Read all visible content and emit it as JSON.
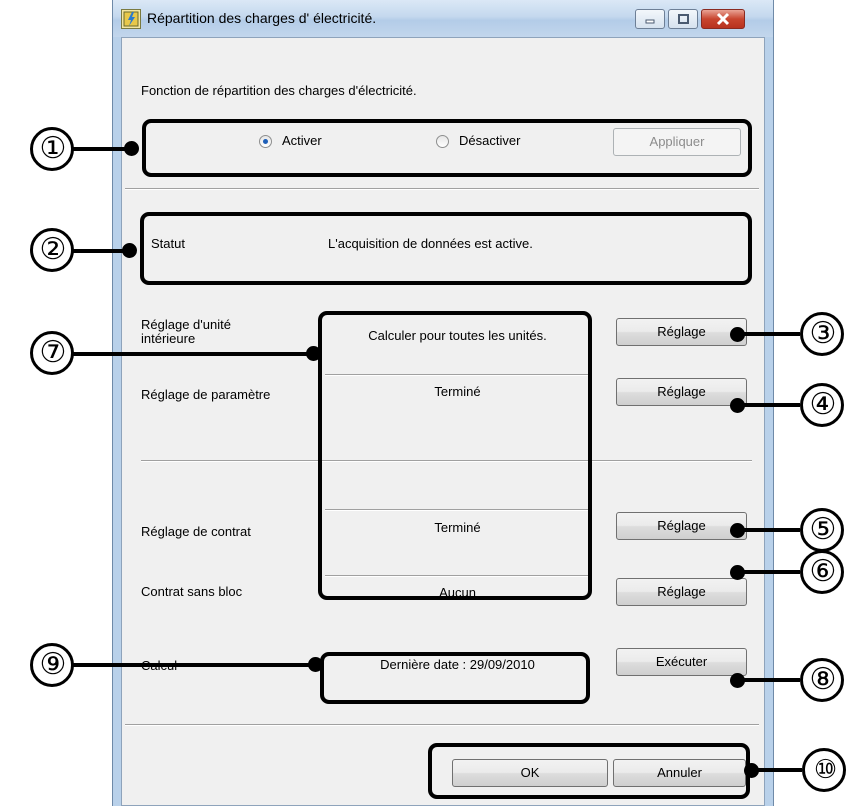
{
  "window": {
    "title": "Répartition des charges d' électricité."
  },
  "function": {
    "heading": "Fonction de répartition des charges d'électricité.",
    "options": [
      {
        "label": "Activer",
        "selected": true
      },
      {
        "label": "Désactiver",
        "selected": false
      }
    ],
    "apply_label": "Appliquer"
  },
  "status": {
    "label": "Statut",
    "value": "L'acquisition de données est active."
  },
  "settings": {
    "rows": [
      {
        "label": "Réglage d'unité\nintérieure",
        "value": "Calculer pour toutes les unités.",
        "button": "Réglage"
      },
      {
        "label": "Réglage de paramètre",
        "value": "Terminé",
        "button": "Réglage"
      },
      {
        "label": "Réglage de contrat",
        "value": "Terminé",
        "button": "Réglage"
      },
      {
        "label": "Contrat sans bloc",
        "value": "Aucun",
        "button": "Réglage"
      }
    ]
  },
  "calc": {
    "label": "Calcul",
    "value": "Dernière date : 29/09/2010",
    "button": "Exécuter"
  },
  "footer": {
    "ok": "OK",
    "cancel": "Annuler"
  },
  "callouts": [
    "①",
    "②",
    "③",
    "④",
    "⑤",
    "⑥",
    "⑦",
    "⑧",
    "⑨",
    "⑩"
  ]
}
